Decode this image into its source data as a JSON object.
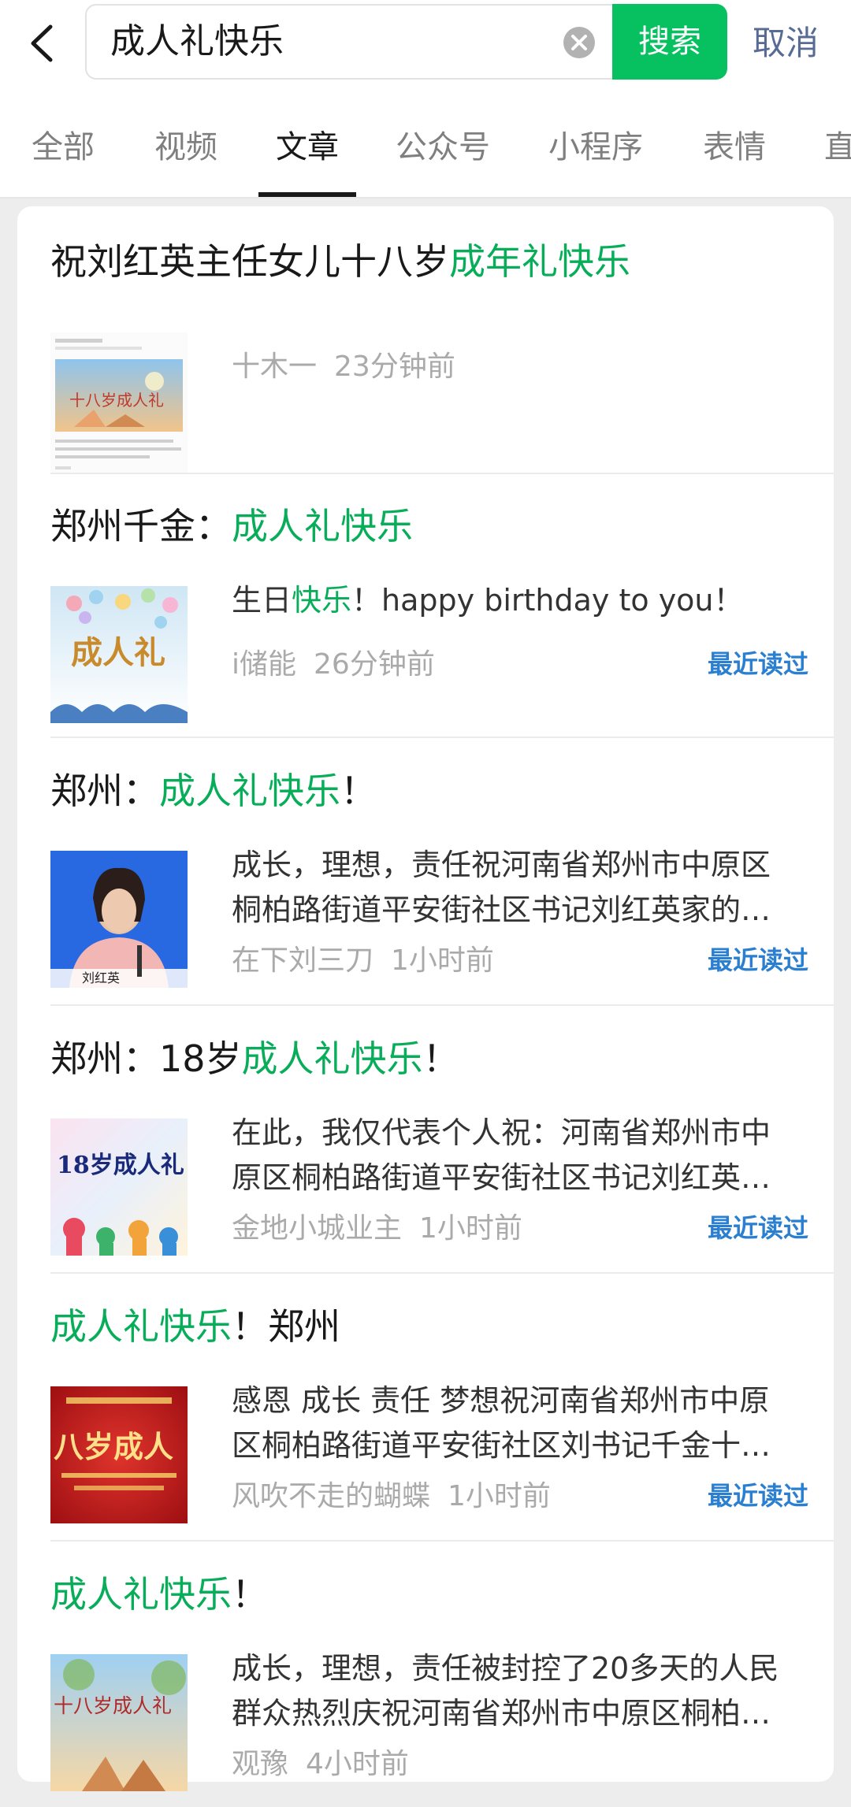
{
  "search": {
    "query": "成人礼快乐",
    "button_label": "搜索",
    "cancel_label": "取消"
  },
  "tabs": [
    {
      "label": "全部",
      "active": false
    },
    {
      "label": "视频",
      "active": false
    },
    {
      "label": "文章",
      "active": true
    },
    {
      "label": "公众号",
      "active": false
    },
    {
      "label": "小程序",
      "active": false
    },
    {
      "label": "表情",
      "active": false
    },
    {
      "label": "直",
      "active": false
    }
  ],
  "results": [
    {
      "title_pre": "祝刘红英主任女儿十八岁",
      "title_hl": "成年礼快乐",
      "title_post": "",
      "thumb_text": "十八岁成人礼",
      "lines": [],
      "author": "十木一",
      "time": "23分钟前",
      "recent": ""
    },
    {
      "title_pre": "郑州千金：",
      "title_hl": "成人礼快乐",
      "title_post": "",
      "thumb_text": "成人礼",
      "lines_rich": {
        "pre": "生日",
        "hl": "快乐",
        "post": "！happy birthday to you！"
      },
      "author": "i储能",
      "time": "26分钟前",
      "recent": "最近读过"
    },
    {
      "title_pre": "郑州：",
      "title_hl": "成人礼快乐",
      "title_post": "！",
      "thumb_text": "刘红英",
      "lines": [
        "成长，理想，责任祝河南省郑州市中原区",
        "桐柏路街道平安街社区书记刘红英家的…"
      ],
      "author": "在下刘三刀",
      "time": "1小时前",
      "recent": "最近读过"
    },
    {
      "title_pre": "郑州：18岁",
      "title_hl": "成人礼快乐",
      "title_post": "！",
      "thumb_text": "18岁成人礼",
      "lines": [
        "在此，我仅代表个人祝：河南省郑州市中",
        "原区桐柏路街道平安街社区书记刘红英…"
      ],
      "author": "金地小城业主",
      "time": "1小时前",
      "recent": "最近读过"
    },
    {
      "title_pre": "",
      "title_hl": "成人礼快乐",
      "title_post": "！郑州",
      "thumb_text": "八岁成人",
      "lines": [
        "感恩 成长 责任 梦想祝河南省郑州市中原",
        "区桐柏路街道平安街社区刘书记千金十…"
      ],
      "author": "风吹不走的蝴蝶",
      "time": "1小时前",
      "recent": "最近读过"
    },
    {
      "title_pre": "",
      "title_hl": "成人礼快乐",
      "title_post": "！",
      "thumb_text": "十八岁成人礼",
      "lines": [
        "成长，理想，责任被封控了20多天的人民",
        "群众热烈庆祝河南省郑州市中原区桐柏…"
      ],
      "author": "观豫",
      "time": "4小时前",
      "recent": ""
    }
  ],
  "colors": {
    "brand_green": "#07c160",
    "highlight_green": "#07ad58",
    "link_blue": "#2b7fd0",
    "cancel_blue": "#576b95"
  }
}
